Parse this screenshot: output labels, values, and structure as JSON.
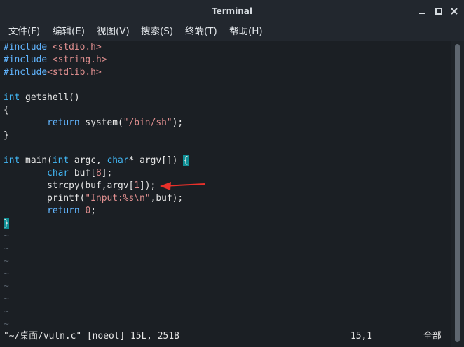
{
  "window": {
    "title": "Terminal"
  },
  "menu": [
    "文件(F)",
    "编辑(E)",
    "视图(V)",
    "搜索(S)",
    "终端(T)",
    "帮助(H)"
  ],
  "code": {
    "l1": [
      "#include",
      " ",
      "<stdio.h>"
    ],
    "l2": [
      "#include",
      " ",
      "<string.h>"
    ],
    "l3": [
      "#include",
      "<stdlib.h>"
    ],
    "l5": [
      "int",
      " getshell()"
    ],
    "l6": "{",
    "l7": [
      "        ",
      "return",
      " system(",
      "\"/bin/sh\"",
      ");"
    ],
    "l8": "}",
    "l10": [
      "int",
      " main(",
      "int",
      " argc, ",
      "char",
      "* argv[]) ",
      "{"
    ],
    "l11": [
      "        ",
      "char",
      " buf[",
      "8",
      "];"
    ],
    "l12": [
      "        strcpy(buf,argv[",
      "1",
      "]);"
    ],
    "l13": [
      "        printf(",
      "\"Input:%s\\n\"",
      ",buf);"
    ],
    "l14": [
      "        ",
      "return",
      " ",
      "0",
      ";"
    ],
    "l15": "}",
    "tilde": "~"
  },
  "status": {
    "file": "\"~/桌面/vuln.c\" [noeol] 15L, 251B",
    "position": "15,1",
    "scroll": "全部"
  },
  "icons": {
    "minimize": "minimize-icon",
    "maximize": "maximize-icon",
    "close": "close-icon",
    "annotation": "red-arrow-annotation"
  },
  "colors": {
    "background": "#1b1f24",
    "keyword": "#61b5ff",
    "string": "#e08f8f",
    "cursor": "#0f8f96",
    "arrow": "#e8302a"
  }
}
